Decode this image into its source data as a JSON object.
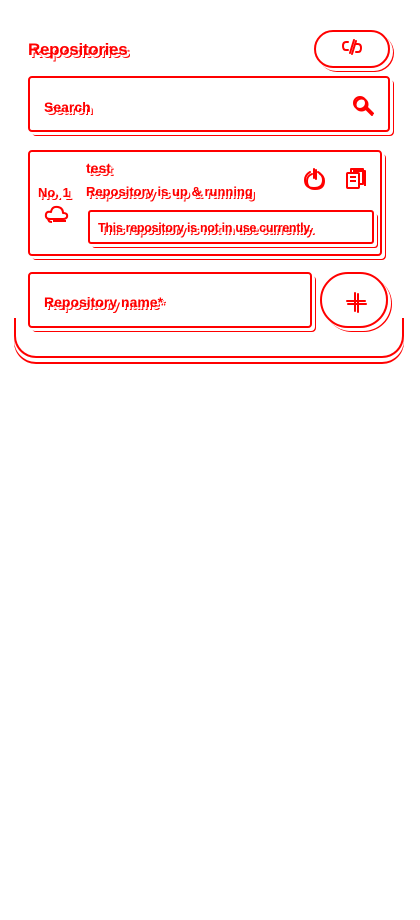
{
  "header": {
    "title": "Repositories",
    "sync_icon": "link-sync-icon"
  },
  "search": {
    "placeholder": "Search",
    "icon": "search-icon"
  },
  "repositories": [
    {
      "number": "No. 1",
      "name": "test",
      "status": "Repository is up & running",
      "notice": "This repository is not in use currently.",
      "icons": [
        "cloud-icon",
        "power-icon",
        "copy-icon"
      ]
    }
  ],
  "create": {
    "name_placeholder": "Repository name*",
    "add_icon": "plus-icon"
  },
  "colors": {
    "accent": "#ff0000",
    "background": "#ffffff"
  }
}
